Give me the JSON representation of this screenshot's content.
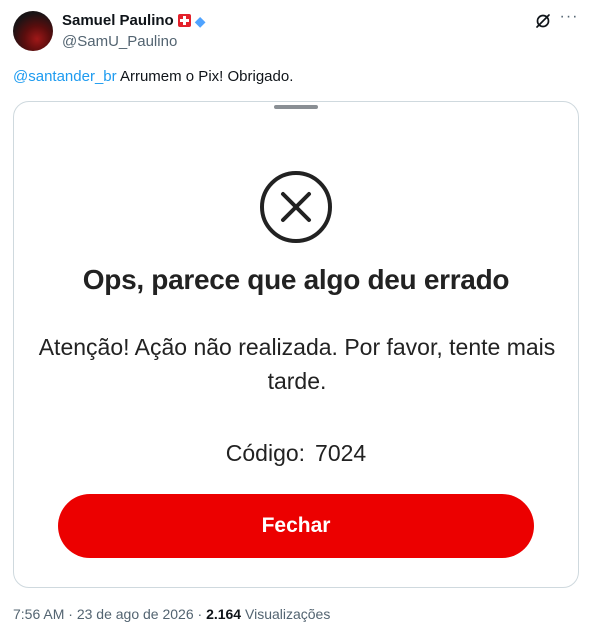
{
  "author": {
    "name": "Samuel Paulino",
    "handle": "@SamU_Paulino",
    "badge_flag_icon": "swiss-flag-icon",
    "badge_diamond_icon": "diamond-icon"
  },
  "tweet": {
    "mention": "@santander_br",
    "text": " Arrumem o Pix! Obrigado."
  },
  "media": {
    "title": "Ops, parece que algo deu errado",
    "message": "Atenção! Ação não realizada. Por favor, tente mais tarde.",
    "code_label": "Código:",
    "code_value": "7024",
    "close_button": "Fechar",
    "accent_color": "#ec0000"
  },
  "meta": {
    "time": "7:56 AM",
    "separator": "·",
    "date": "23 de ago de 2026",
    "views_count": "2.164",
    "views_label": "Visualizações"
  }
}
